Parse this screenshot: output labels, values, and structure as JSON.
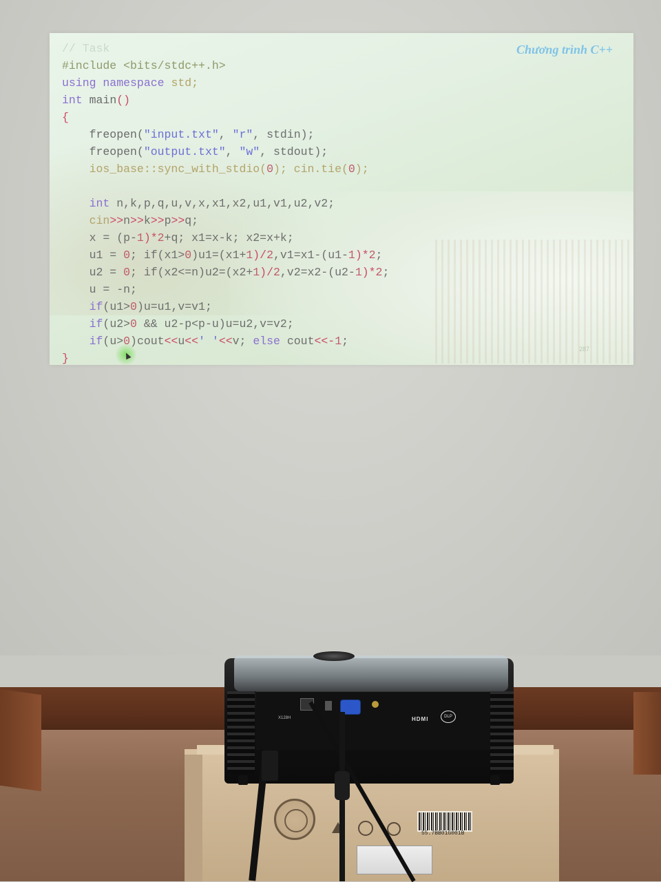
{
  "slide": {
    "title": "Chương trình C++",
    "page_number": "287",
    "code_lines": [
      [
        {
          "t": "// Task",
          "c": "comment"
        }
      ],
      [
        {
          "t": "#include <bits/stdc++.h>",
          "c": "prep"
        }
      ],
      [
        {
          "t": "using namespace ",
          "c": "kw"
        },
        {
          "t": "std;",
          "c": "cin"
        }
      ],
      [
        {
          "t": "int ",
          "c": "kw"
        },
        {
          "t": "main",
          "c": "fn"
        },
        {
          "t": "()",
          "c": "op"
        }
      ],
      [
        {
          "t": "{",
          "c": "op"
        }
      ],
      [
        {
          "t": "    freopen(",
          "c": "fn"
        },
        {
          "t": "\"input.txt\"",
          "c": "str"
        },
        {
          "t": ", ",
          "c": "id"
        },
        {
          "t": "\"r\"",
          "c": "str"
        },
        {
          "t": ", stdin);",
          "c": "id"
        }
      ],
      [
        {
          "t": "    freopen(",
          "c": "fn"
        },
        {
          "t": "\"output.txt\"",
          "c": "str"
        },
        {
          "t": ", ",
          "c": "id"
        },
        {
          "t": "\"w\"",
          "c": "str"
        },
        {
          "t": ", stdout);",
          "c": "id"
        }
      ],
      [
        {
          "t": "    ios_base::sync_with_stdio(",
          "c": "cin"
        },
        {
          "t": "0",
          "c": "num"
        },
        {
          "t": "); cin.tie(",
          "c": "cin"
        },
        {
          "t": "0",
          "c": "num"
        },
        {
          "t": ");",
          "c": "cin"
        }
      ],
      [
        {
          "t": "",
          "c": "id"
        }
      ],
      [
        {
          "t": "    int ",
          "c": "kw"
        },
        {
          "t": "n,k,p,q,u,v,x,x1,x2,u1,v1,u2,v2;",
          "c": "id"
        }
      ],
      [
        {
          "t": "    cin",
          "c": "cin"
        },
        {
          "t": ">>",
          "c": "op"
        },
        {
          "t": "n",
          "c": "id"
        },
        {
          "t": ">>",
          "c": "op"
        },
        {
          "t": "k",
          "c": "id"
        },
        {
          "t": ">>",
          "c": "op"
        },
        {
          "t": "p",
          "c": "id"
        },
        {
          "t": ">>",
          "c": "op"
        },
        {
          "t": "q;",
          "c": "id"
        }
      ],
      [
        {
          "t": "    x = (p-",
          "c": "id"
        },
        {
          "t": "1",
          "c": "num"
        },
        {
          "t": ")*",
          "c": "op"
        },
        {
          "t": "2",
          "c": "num"
        },
        {
          "t": "+q; x1=x-k; x2=x+k;",
          "c": "id"
        }
      ],
      [
        {
          "t": "    u1 = ",
          "c": "id"
        },
        {
          "t": "0",
          "c": "num"
        },
        {
          "t": "; if(x1>",
          "c": "id"
        },
        {
          "t": "0",
          "c": "num"
        },
        {
          "t": ")u1=(x1+",
          "c": "id"
        },
        {
          "t": "1",
          "c": "num"
        },
        {
          "t": ")/",
          "c": "op"
        },
        {
          "t": "2",
          "c": "num"
        },
        {
          "t": ",v1=x1-(u1-",
          "c": "id"
        },
        {
          "t": "1",
          "c": "num"
        },
        {
          "t": ")*",
          "c": "op"
        },
        {
          "t": "2",
          "c": "num"
        },
        {
          "t": ";",
          "c": "id"
        }
      ],
      [
        {
          "t": "    u2 = ",
          "c": "id"
        },
        {
          "t": "0",
          "c": "num"
        },
        {
          "t": "; if(x2<=n)u2=(x2+",
          "c": "id"
        },
        {
          "t": "1",
          "c": "num"
        },
        {
          "t": ")/",
          "c": "op"
        },
        {
          "t": "2",
          "c": "num"
        },
        {
          "t": ",v2=x2-(u2-",
          "c": "id"
        },
        {
          "t": "1",
          "c": "num"
        },
        {
          "t": ")*",
          "c": "op"
        },
        {
          "t": "2",
          "c": "num"
        },
        {
          "t": ";",
          "c": "id"
        }
      ],
      [
        {
          "t": "    u = -n;",
          "c": "id"
        }
      ],
      [
        {
          "t": "    if",
          "c": "kw"
        },
        {
          "t": "(u1>",
          "c": "id"
        },
        {
          "t": "0",
          "c": "num"
        },
        {
          "t": ")u=u1,v=v1;",
          "c": "id"
        }
      ],
      [
        {
          "t": "    if",
          "c": "kw"
        },
        {
          "t": "(u2>",
          "c": "id"
        },
        {
          "t": "0",
          "c": "num"
        },
        {
          "t": " && u2-p<p-u)u=u2,v=v2;",
          "c": "id"
        }
      ],
      [
        {
          "t": "    if",
          "c": "kw"
        },
        {
          "t": "(u>",
          "c": "id"
        },
        {
          "t": "0",
          "c": "num"
        },
        {
          "t": ")cout",
          "c": "id"
        },
        {
          "t": "<<",
          "c": "op"
        },
        {
          "t": "u",
          "c": "id"
        },
        {
          "t": "<<",
          "c": "op"
        },
        {
          "t": "' '",
          "c": "str"
        },
        {
          "t": "<<",
          "c": "op"
        },
        {
          "t": "v; ",
          "c": "id"
        },
        {
          "t": "else ",
          "c": "kw"
        },
        {
          "t": "cout",
          "c": "id"
        },
        {
          "t": "<<-",
          "c": "op"
        },
        {
          "t": "1",
          "c": "num"
        },
        {
          "t": ";",
          "c": "id"
        }
      ],
      [
        {
          "t": "}",
          "c": "op"
        }
      ]
    ]
  },
  "projector": {
    "model_label": "X128H",
    "hdmi_label": "HDMI",
    "dlp_label": "DLP"
  },
  "box": {
    "barcode_text": "55.7BB01G001B"
  },
  "colors": {
    "title": "#7fc3e6",
    "keyword": "#8a6fd0",
    "string": "#6c6fd6",
    "number": "#c05b6a",
    "operator": "#cc4a66",
    "vga_port": "#2b57c9",
    "desk": "#5a2f1b"
  }
}
